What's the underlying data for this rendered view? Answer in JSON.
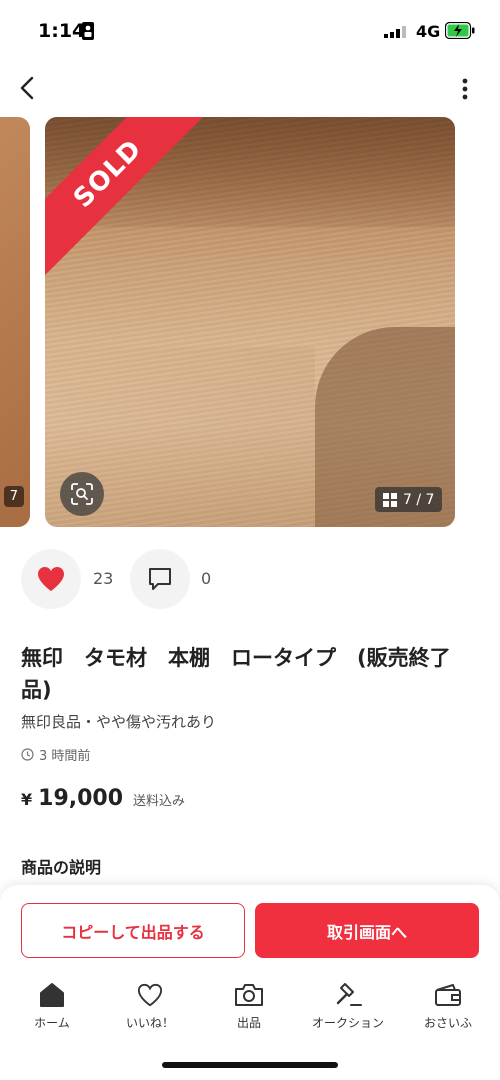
{
  "status_bar": {
    "time": "1:14",
    "network": "4G"
  },
  "carousel": {
    "sold_label": "SOLD",
    "prev_counter": "7",
    "counter": "7 / 7"
  },
  "reactions": {
    "likes": "23",
    "comments": "0"
  },
  "product": {
    "title": "無印　タモ材　本棚　ロータイプ　(販売終了品)",
    "subtitle": "無印良品・やや傷や汚れあり",
    "time_ago": "3 時間前",
    "price_symbol": "¥",
    "price": "19,000",
    "shipping": "送料込み",
    "description_heading": "商品の説明"
  },
  "actions": {
    "copy_label": "コピーして出品する",
    "trade_label": "取引画面へ"
  },
  "nav": {
    "items": [
      {
        "label": "ホーム",
        "icon": "home-icon"
      },
      {
        "label": "いいね！",
        "icon": "heart-icon"
      },
      {
        "label": "出品",
        "icon": "camera-icon"
      },
      {
        "label": "オークション",
        "icon": "gavel-icon"
      },
      {
        "label": "おさいふ",
        "icon": "wallet-icon"
      }
    ]
  },
  "colors": {
    "accent": "#e8313f",
    "like": "#e8313f"
  }
}
